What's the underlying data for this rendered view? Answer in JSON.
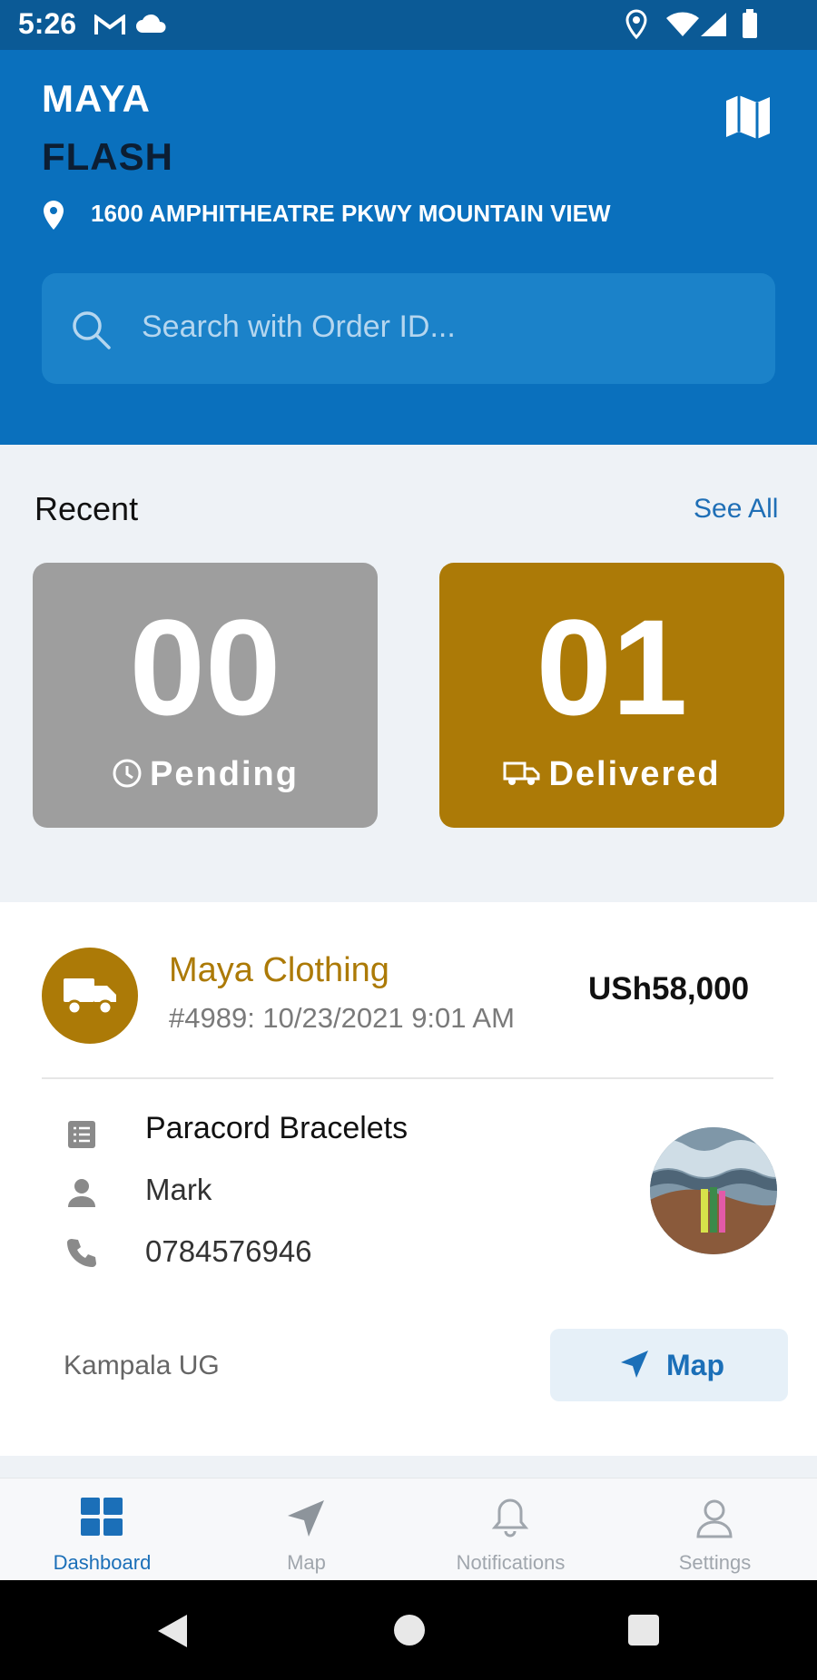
{
  "status_bar": {
    "time": "5:26"
  },
  "header": {
    "brand_line1": "MAYA",
    "brand_line2": "FLASH",
    "address": "1600 AMPHITHEATRE PKWY MOUNTAIN VIEW",
    "search_placeholder": "Search with Order ID..."
  },
  "recent": {
    "title": "Recent",
    "see_all": "See All",
    "pending": {
      "count": "00",
      "label": "Pending"
    },
    "delivered": {
      "count": "01",
      "label": "Delivered"
    }
  },
  "order": {
    "store": "Maya Clothing",
    "meta": "#4989: 10/23/2021 9:01 AM",
    "price": "USh58,000",
    "product": "Paracord Bracelets",
    "customer": "Mark",
    "phone": "0784576946",
    "location": "Kampala UG",
    "map_button": "Map"
  },
  "bottom_nav": [
    {
      "label": "Dashboard",
      "icon": "grid-icon",
      "active": true
    },
    {
      "label": "Map",
      "icon": "navigation-icon",
      "active": false
    },
    {
      "label": "Notifications",
      "icon": "bell-icon",
      "active": false
    },
    {
      "label": "Settings",
      "icon": "user-icon",
      "active": false
    }
  ],
  "colors": {
    "header": "#0a70bd",
    "accent": "#ac7a07",
    "pending": "#9e9e9e",
    "link": "#1f6fb6"
  }
}
